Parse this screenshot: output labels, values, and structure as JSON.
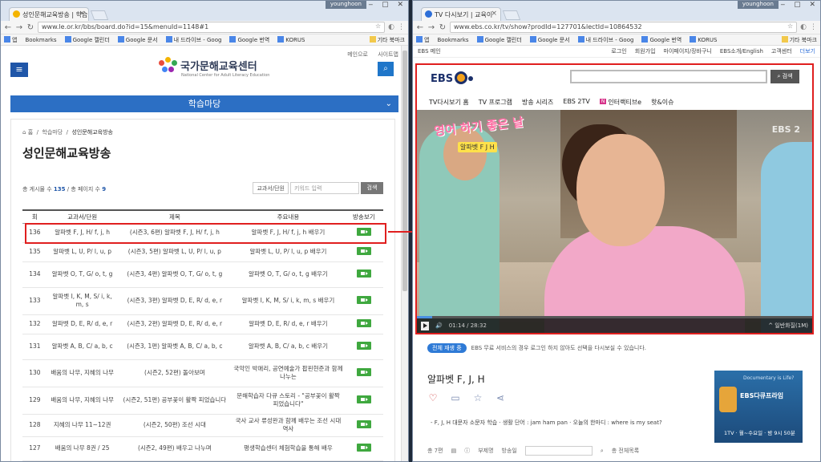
{
  "left_window": {
    "tab_title": "성인문해교육방송 | 학습",
    "user": "younghoon",
    "url": "www.le.or.kr/bbs/board.do?id=15&menuId=1148#1",
    "bookmarks": [
      "앱",
      "Bookmarks",
      "Google 캘린더",
      "Google 문서",
      "내 드라이브 - Goog",
      "Google 번역",
      "KORUS"
    ],
    "bookmark_folder": "기타 북마크",
    "top_links": [
      "메인으로",
      "사이트맵"
    ],
    "logo_title": "국가문해교육센터",
    "logo_sub": "National Center for Adult Literacy Education",
    "section_bar": "학습마당",
    "breadcrumb": {
      "home": "홈",
      "parent": "학습마당",
      "current": "성인문해교육방송"
    },
    "page_title": "성인문해교육방송",
    "count_text_prefix": "총 게시물 수 ",
    "count_total": "135",
    "count_text_mid": " / 총 페이지 수 ",
    "count_pages": "9",
    "filter_select": "교과서/단원",
    "keyword_placeholder": "키워드 입력",
    "search_label": "검색",
    "columns": [
      "회",
      "교과서/단원",
      "제목",
      "주요내용",
      "방송보기"
    ],
    "rows": [
      {
        "no": "136",
        "unit": "알파벳 F, J, H/ f, j, h",
        "title": "(시즌3, 6편) 알파벳 F, J, H/ f, j, h",
        "content": "알파벳 F, J, H/ f, j, h 배우기"
      },
      {
        "no": "135",
        "unit": "알파벳 L, U, P/ l, u, p",
        "title": "(시즌3, 5편) 알파벳 L, U, P/ l, u, p",
        "content": "알파벳 L, U, P/ l, u, p 배우기"
      },
      {
        "no": "134",
        "unit": "알파벳 O, T, G/ o, t, g",
        "title": "(시즌3, 4편) 알파벳 O, T, G/ o, t, g",
        "content": "알파벳 O, T, G/ o, t, g 배우기"
      },
      {
        "no": "133",
        "unit": "알파벳 I, K, M, S/ i, k, m, s",
        "title": "(시즌3, 3편) 알파벳 D, E, R/ d, e, r",
        "content": "알파벳 I, K, M, S/ i, k, m, s 배우기"
      },
      {
        "no": "132",
        "unit": "알파벳 D, E, R/ d, e, r",
        "title": "(시즌3, 2편) 알파벳 D, E, R/ d, e, r",
        "content": "알파벳 D, E, R/ d, e, r 배우기"
      },
      {
        "no": "131",
        "unit": "알파벳 A, B, C/ a, b, c",
        "title": "(시즌3, 1편) 알파벳 A, B, C/ a, b, c",
        "content": "알파벳 A, B, C/ a, b, c 배우기"
      },
      {
        "no": "130",
        "unit": "배움의 나무, 지혜의 나무",
        "title": "(시즌2, 52편) 돌아보며",
        "content": "국악인 박애리, 공연예술가 팝핀현준과 함께 나누는"
      },
      {
        "no": "129",
        "unit": "배움의 나무, 지혜의 나무",
        "title": "(시즌2, 51편) 공부꽃이 활짝 피었습니다",
        "content": "문해학습자 다큐 스토리 - \"공부꽃이 활짝 피었습니다\""
      },
      {
        "no": "128",
        "unit": "지혜의 나무 11~12권",
        "title": "(시즌2, 50편) 조선 시대",
        "content": "국사 교사 류성완과 함께 배우는 조선 시대 역사"
      },
      {
        "no": "127",
        "unit": "배움의 나무 8권 / 25",
        "title": "(시즌2, 49편) 배우고 나누며",
        "content": "평생학습센터 체험학습을 통해 배우"
      }
    ]
  },
  "right_window": {
    "tab_title": "TV 다시보기 | 교육이",
    "user": "younghoon",
    "url": "www.ebs.co.kr/tv/show?prodId=127701&lectId=10864532",
    "bookmarks": [
      "앱",
      "Bookmarks",
      "Google 캘린더",
      "Google 문서",
      "내 드라이브 - Goog",
      "Google 번역",
      "KORUS"
    ],
    "bookmark_folder": "기타 북마크",
    "site_label": "EBS 메인",
    "top_links": [
      "로그인",
      "회원가입",
      "마이페이지/장바구니",
      "EBS소개/English",
      "고객센터",
      "더보기"
    ],
    "logo": "EBS",
    "search_button": "검색",
    "nav": [
      "TV다시보기 홈",
      "TV 프로그램",
      "방송 시리즈",
      "EBS 2TV",
      "인터랙티브e",
      "핫&이슈"
    ],
    "nav_badge": "N",
    "video_caption": "영어 하기 좋은 날",
    "video_caption2": "알파벳 F J H",
    "channel_bug": "EBS 2",
    "time_current": "01:14",
    "time_total": "28:32",
    "progress": 0.04,
    "quality": "일반화질(1M)",
    "notice_pill": "전체 재생 중",
    "notice_text": "EBS 무료 서비스의 경우 로그인 하지 않아도 선택을 다시보실 수 있습니다.",
    "episode_title": "알파벳 F, J, H",
    "episode_desc": "- F, J, H 대문자 소문자 학습 · 생활 단어 : jam ham pan · 오늘의 한마디 : where is my seat?",
    "footer_count": "총 7편",
    "footer_label1": "부제명",
    "footer_label2": "방송일",
    "footer_label3": "총 전체목록",
    "ad_question": "Documentary is Life?",
    "ad_title": "EBS다큐프라임",
    "ad_bottom": "1TV · 월~수요일 · 밤 9시 50분"
  }
}
